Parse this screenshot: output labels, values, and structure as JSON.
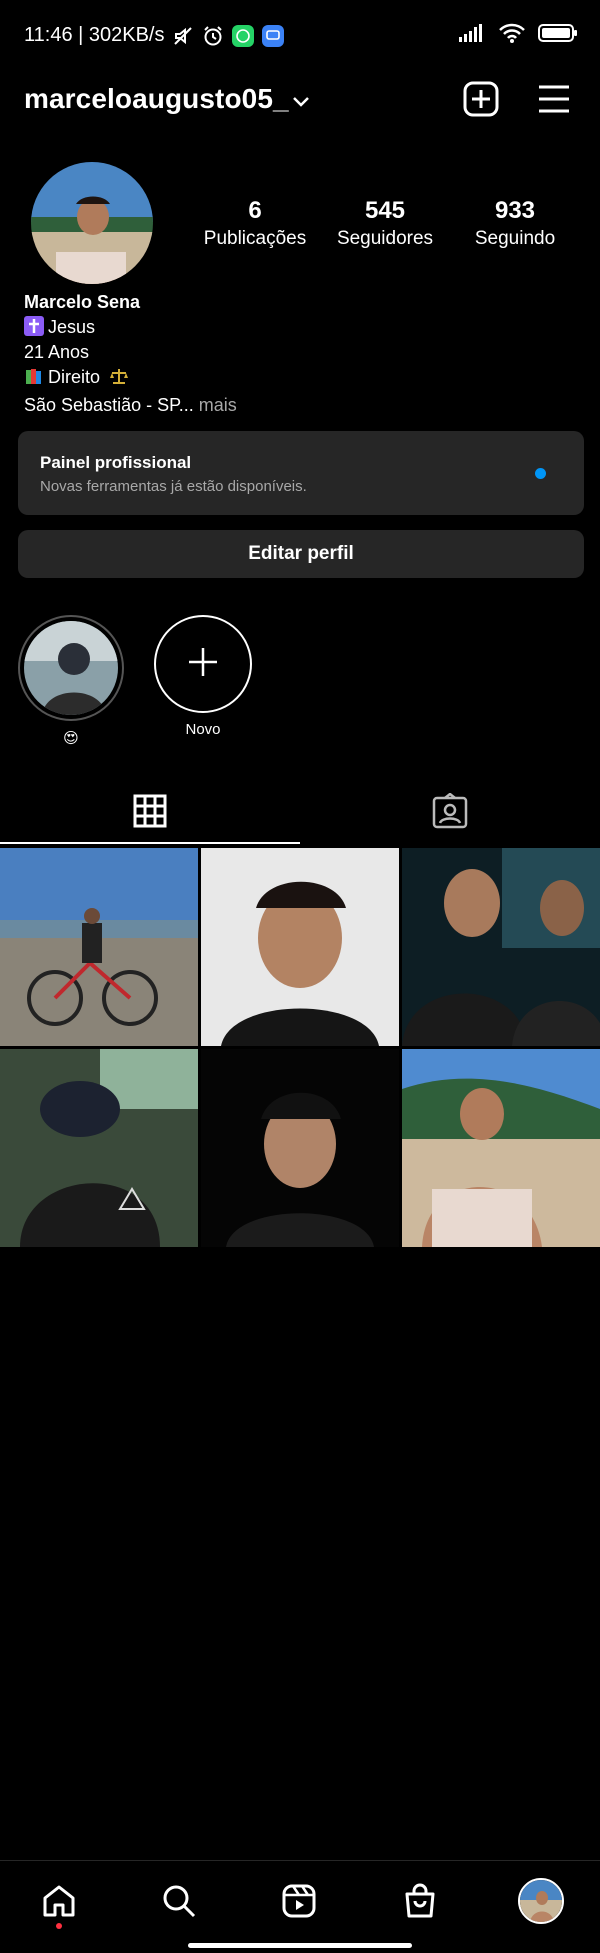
{
  "status_bar": {
    "time_speed": "11:46 | 302KB/s",
    "icons_left": [
      "mute-icon",
      "alarm-icon",
      "whatsapp-icon",
      "messages-icon"
    ],
    "icons_right": [
      "signal-icon",
      "wifi-icon",
      "battery-icon"
    ]
  },
  "header": {
    "username": "marceloaugusto05_",
    "icons": [
      "chevron-down-icon",
      "new-post-icon",
      "menu-icon"
    ]
  },
  "profile": {
    "stats": [
      {
        "value": "6",
        "label": "Publicações"
      },
      {
        "value": "545",
        "label": "Seguidores"
      },
      {
        "value": "933",
        "label": "Seguindo"
      }
    ],
    "bio": {
      "name": "Marcelo Sena",
      "line1": "Jesus",
      "line2": "21 Anos",
      "line3": "Direito",
      "line4": "São Sebastião - SP...",
      "more": " mais"
    }
  },
  "pro_panel": {
    "title": "Painel profissional",
    "subtitle": "Novas ferramentas já estão disponíveis.",
    "dot_color": "#0095f6"
  },
  "edit_button": {
    "label": "Editar perfil"
  },
  "highlights": [
    {
      "label": "😍"
    },
    {
      "label": "Novo"
    }
  ],
  "tabs": [
    "grid-icon",
    "tagged-icon"
  ],
  "bottom_nav": [
    "home-icon",
    "search-icon",
    "reels-icon",
    "shop-icon",
    "profile-avatar"
  ],
  "colors": {
    "background": "#000000",
    "surface": "#262626",
    "secondary_text": "#a8a8a8",
    "notification": "#ff3040"
  }
}
